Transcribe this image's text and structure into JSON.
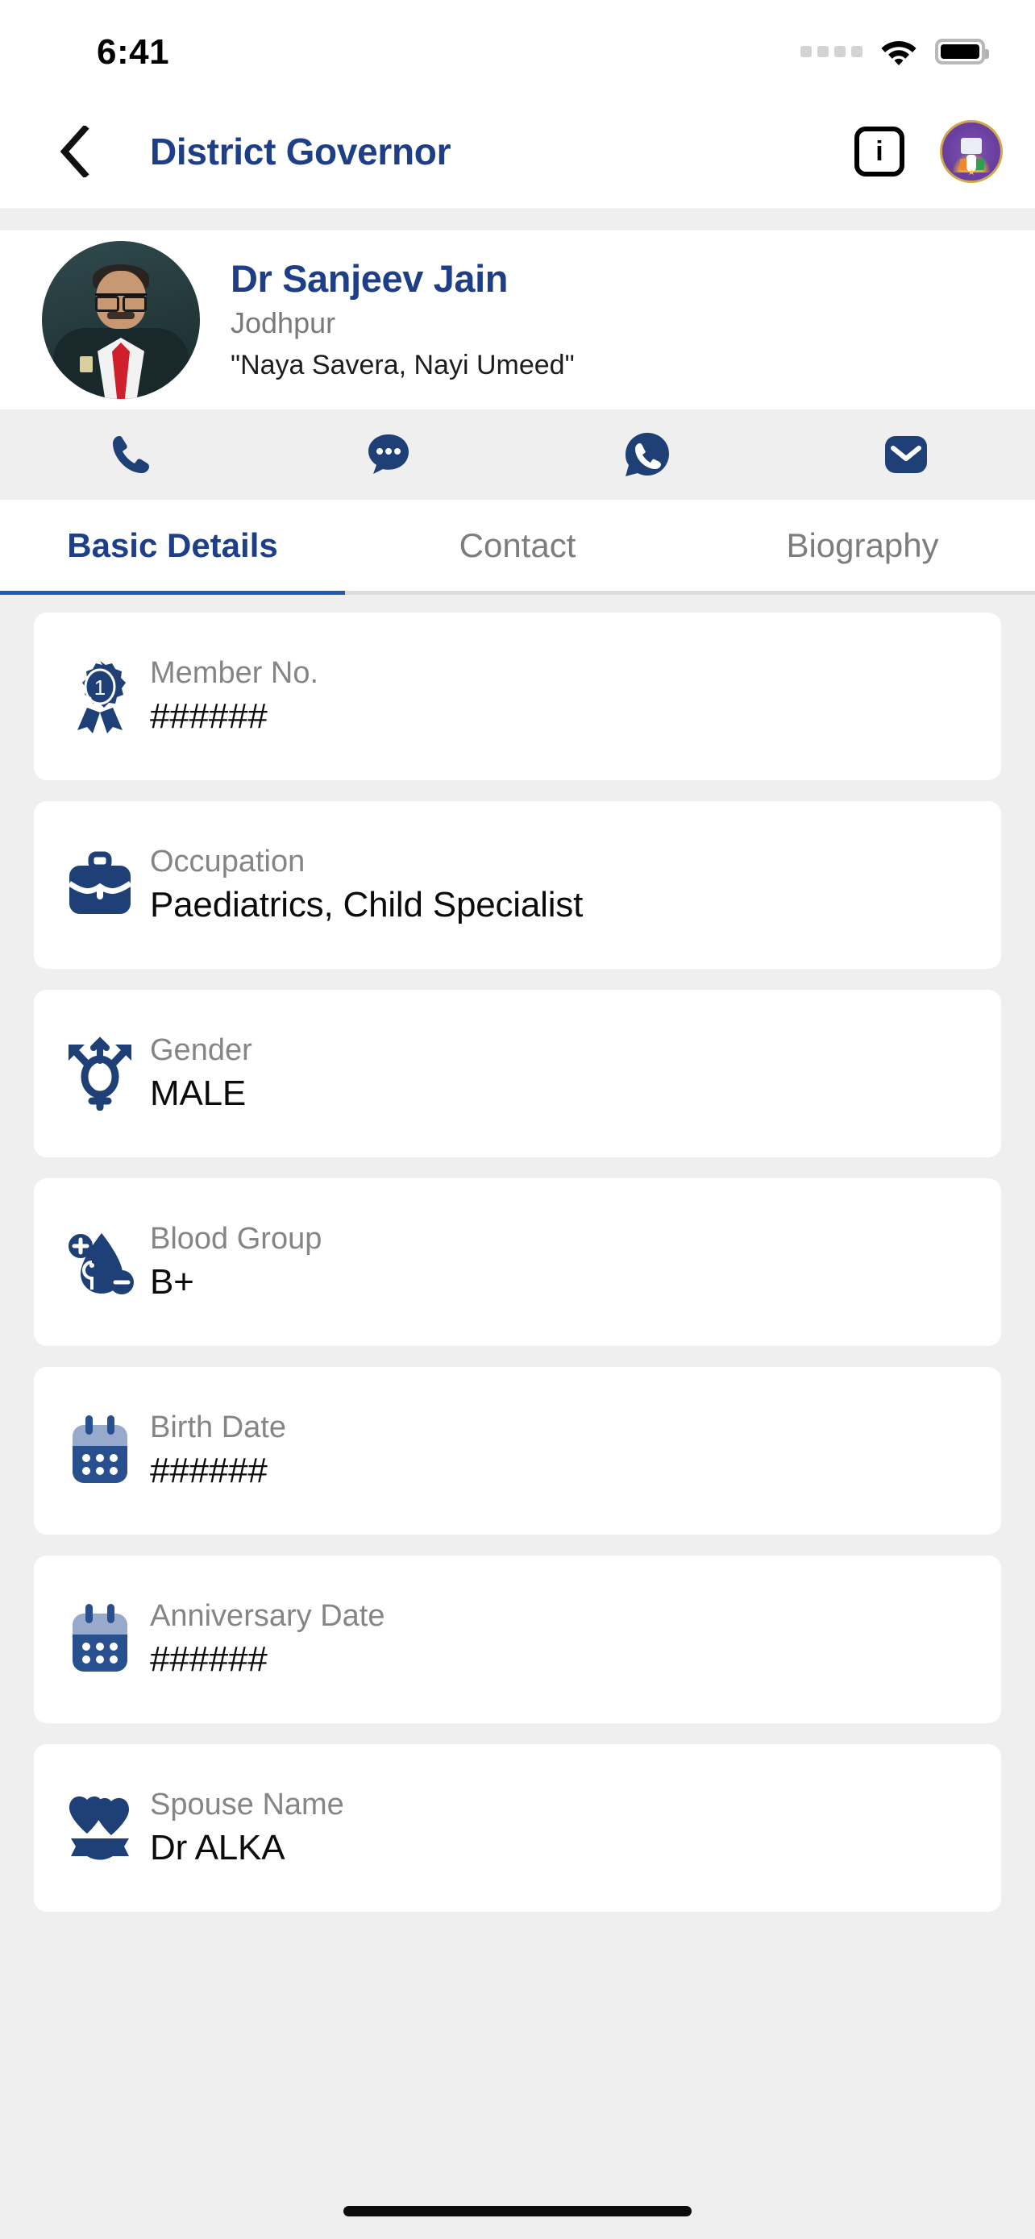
{
  "status_bar": {
    "time": "6:41",
    "signal_icon": "signal-dots-icon",
    "wifi_icon": "wifi-icon",
    "battery_icon": "battery-full-icon"
  },
  "nav": {
    "back_icon": "chevron-left-icon",
    "title": "District Governor",
    "info_label": "i",
    "info_icon": "info-icon",
    "logo_icon": "lions-club-logo-icon"
  },
  "profile": {
    "avatar_icon": "profile-photo",
    "name": "Dr Sanjeev  Jain",
    "city": "Jodhpur",
    "tagline": "\"Naya Savera, Nayi Umeed\""
  },
  "actions": [
    {
      "name": "call",
      "icon": "phone-icon"
    },
    {
      "name": "message",
      "icon": "chat-bubble-icon"
    },
    {
      "name": "whatsapp",
      "icon": "whatsapp-icon"
    },
    {
      "name": "email",
      "icon": "envelope-icon"
    }
  ],
  "tabs": [
    {
      "label": "Basic Details",
      "active": true
    },
    {
      "label": "Contact",
      "active": false
    },
    {
      "label": "Biography",
      "active": false
    }
  ],
  "details": [
    {
      "icon": "award-ribbon-icon",
      "label": "Member No.",
      "value": "######"
    },
    {
      "icon": "briefcase-icon",
      "label": "Occupation",
      "value": "Paediatrics, Child Specialist"
    },
    {
      "icon": "gender-icon",
      "label": "Gender",
      "value": "MALE"
    },
    {
      "icon": "blood-drop-icon",
      "label": "Blood Group",
      "value": "B+"
    },
    {
      "icon": "calendar-icon",
      "label": "Birth Date",
      "value": "######"
    },
    {
      "icon": "calendar-icon",
      "label": "Anniversary Date",
      "value": "######"
    },
    {
      "icon": "hearts-ribbon-icon",
      "label": "Spouse Name",
      "value": "Dr ALKA"
    }
  ],
  "colors": {
    "brand_navy": "#1e3f87",
    "icon_navy": "#1f4076",
    "tab_underline": "#1d5bb5",
    "page_bg": "#efefef",
    "label_gray": "#858585"
  }
}
